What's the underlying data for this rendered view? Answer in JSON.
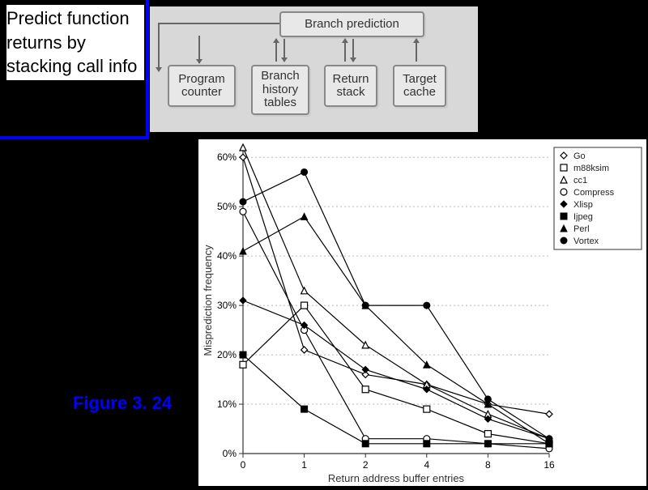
{
  "title_text": "Predict function returns by stacking call info",
  "figure_label": "Figure 3. 24",
  "diagram": {
    "branch_prediction": "Branch prediction",
    "program_counter": "Program\ncounter",
    "branch_history": "Branch\nhistory\ntables",
    "return_stack": "Return\nstack",
    "target_cache": "Target\ncache"
  },
  "chart_data": {
    "type": "line",
    "title": "",
    "xlabel": "Return address buffer entries",
    "ylabel": "Misprediction frequency",
    "x_ticks": [
      0,
      1,
      2,
      4,
      8,
      16
    ],
    "y_ticks": [
      0,
      10,
      20,
      30,
      40,
      50,
      60
    ],
    "ylim": [
      0,
      62
    ],
    "series": [
      {
        "name": "Go",
        "marker": "diamond",
        "filled": false,
        "values": [
          60,
          21,
          16,
          14,
          10,
          8
        ]
      },
      {
        "name": "m88ksim",
        "marker": "square",
        "filled": false,
        "values": [
          18,
          30,
          13,
          9,
          4,
          2
        ]
      },
      {
        "name": "cc1",
        "marker": "triangle",
        "filled": false,
        "values": [
          62,
          33,
          22,
          14,
          8,
          3
        ]
      },
      {
        "name": "Compress",
        "marker": "circle",
        "filled": false,
        "values": [
          49,
          25,
          3,
          3,
          2,
          1
        ]
      },
      {
        "name": "Xlisp",
        "marker": "diamond",
        "filled": true,
        "values": [
          31,
          26,
          17,
          13,
          7,
          3
        ]
      },
      {
        "name": "Ijpeg",
        "marker": "square",
        "filled": true,
        "values": [
          20,
          9,
          2,
          2,
          2,
          2
        ]
      },
      {
        "name": "Perl",
        "marker": "triangle",
        "filled": true,
        "values": [
          41,
          48,
          30,
          18,
          10,
          2
        ]
      },
      {
        "name": "Vortex",
        "marker": "circle",
        "filled": true,
        "values": [
          51,
          57,
          30,
          30,
          11,
          3
        ]
      }
    ],
    "legend": [
      "Go",
      "m88ksim",
      "cc1",
      "Compress",
      "Xlisp",
      "Ijpeg",
      "Perl",
      "Vortex"
    ]
  }
}
